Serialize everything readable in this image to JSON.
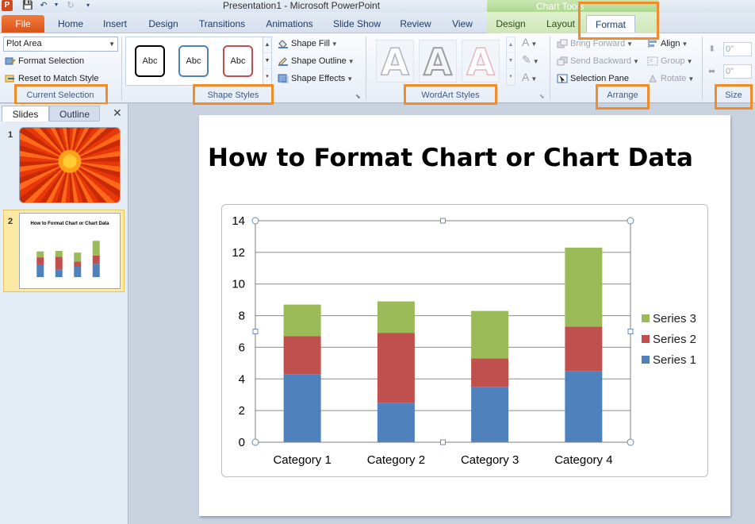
{
  "window": {
    "title": "Presentation1 - Microsoft PowerPoint",
    "context_tools_label": "Chart Tools",
    "app_icon": "P"
  },
  "tabs": [
    {
      "label": "File"
    },
    {
      "label": "Home"
    },
    {
      "label": "Insert"
    },
    {
      "label": "Design"
    },
    {
      "label": "Transitions"
    },
    {
      "label": "Animations"
    },
    {
      "label": "Slide Show"
    },
    {
      "label": "Review"
    },
    {
      "label": "View"
    },
    {
      "label": "Design"
    },
    {
      "label": "Layout"
    },
    {
      "label": "Format"
    }
  ],
  "ribbon": {
    "current_selection": {
      "combo_value": "Plot Area",
      "format_selection": "Format Selection",
      "reset_to_match_style": "Reset to Match Style",
      "label": "Current Selection"
    },
    "shape_styles": {
      "samples": [
        "Abc",
        "Abc",
        "Abc"
      ],
      "shape_fill": "Shape Fill",
      "shape_outline": "Shape Outline",
      "shape_effects": "Shape Effects",
      "label": "Shape Styles"
    },
    "wordart_styles": {
      "samples": [
        "A",
        "A",
        "A"
      ],
      "label": "WordArt Styles"
    },
    "arrange": {
      "bring_forward": "Bring Forward",
      "send_backward": "Send Backward",
      "selection_pane": "Selection Pane",
      "align": "Align",
      "group": "Group",
      "rotate": "Rotate",
      "label": "Arrange"
    },
    "size": {
      "height": "0\"",
      "width": "0\"",
      "label": "Size"
    }
  },
  "left_pane": {
    "tab_slides": "Slides",
    "tab_outline": "Outline",
    "close": "✕",
    "slide_numbers": [
      "1",
      "2"
    ]
  },
  "slide": {
    "title": "How to Format Chart or Chart Data"
  },
  "colors": {
    "series1": "#4f81bd",
    "series2": "#c0504d",
    "series3": "#9bbb59",
    "highlight": "#f08c2a"
  },
  "chart_data": {
    "type": "bar",
    "stacked": true,
    "categories": [
      "Category 1",
      "Category 2",
      "Category 3",
      "Category 4"
    ],
    "series": [
      {
        "name": "Series 1",
        "values": [
          4.3,
          2.5,
          3.5,
          4.5
        ]
      },
      {
        "name": "Series 2",
        "values": [
          2.4,
          4.4,
          1.8,
          2.8
        ]
      },
      {
        "name": "Series 3",
        "values": [
          2.0,
          2.0,
          3.0,
          5.0
        ]
      }
    ],
    "ylim": [
      0,
      14
    ],
    "yticks": [
      "0",
      "2",
      "4",
      "6",
      "8",
      "10",
      "12",
      "14"
    ],
    "grid": true,
    "legend": "right"
  }
}
